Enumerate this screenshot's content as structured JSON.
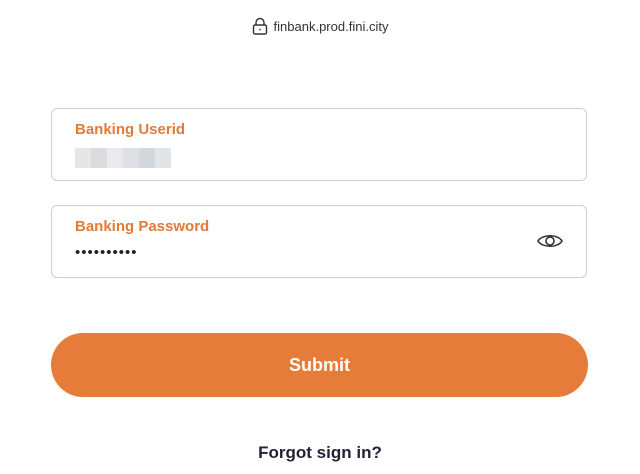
{
  "browser": {
    "url": "finbank.prod.fini.city",
    "lock_icon": "lock-icon"
  },
  "form": {
    "userid": {
      "label": "Banking Userid",
      "value_redacted": true
    },
    "password": {
      "label": "Banking Password",
      "value": "••••••••••",
      "toggle_icon": "eye-icon"
    },
    "submit_label": "Submit",
    "forgot_label": "Forgot sign in?"
  },
  "colors": {
    "accent": "#e57c3a",
    "label": "#e07b39",
    "border": "#cfcfcf",
    "link": "#1f2233"
  }
}
